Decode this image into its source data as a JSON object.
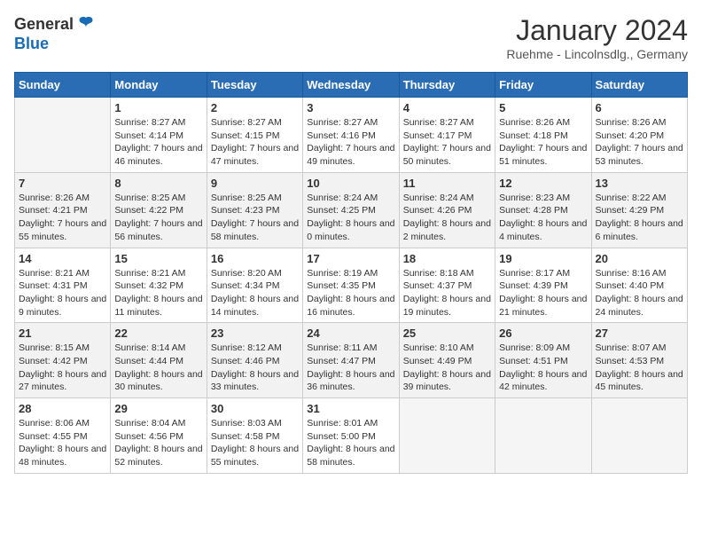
{
  "header": {
    "logo_general": "General",
    "logo_blue": "Blue",
    "month_title": "January 2024",
    "subtitle": "Ruehme - Lincolnsdlg., Germany"
  },
  "weekdays": [
    "Sunday",
    "Monday",
    "Tuesday",
    "Wednesday",
    "Thursday",
    "Friday",
    "Saturday"
  ],
  "weeks": [
    [
      {
        "num": "",
        "sunrise": "",
        "sunset": "",
        "daylight": ""
      },
      {
        "num": "1",
        "sunrise": "Sunrise: 8:27 AM",
        "sunset": "Sunset: 4:14 PM",
        "daylight": "Daylight: 7 hours and 46 minutes."
      },
      {
        "num": "2",
        "sunrise": "Sunrise: 8:27 AM",
        "sunset": "Sunset: 4:15 PM",
        "daylight": "Daylight: 7 hours and 47 minutes."
      },
      {
        "num": "3",
        "sunrise": "Sunrise: 8:27 AM",
        "sunset": "Sunset: 4:16 PM",
        "daylight": "Daylight: 7 hours and 49 minutes."
      },
      {
        "num": "4",
        "sunrise": "Sunrise: 8:27 AM",
        "sunset": "Sunset: 4:17 PM",
        "daylight": "Daylight: 7 hours and 50 minutes."
      },
      {
        "num": "5",
        "sunrise": "Sunrise: 8:26 AM",
        "sunset": "Sunset: 4:18 PM",
        "daylight": "Daylight: 7 hours and 51 minutes."
      },
      {
        "num": "6",
        "sunrise": "Sunrise: 8:26 AM",
        "sunset": "Sunset: 4:20 PM",
        "daylight": "Daylight: 7 hours and 53 minutes."
      }
    ],
    [
      {
        "num": "7",
        "sunrise": "Sunrise: 8:26 AM",
        "sunset": "Sunset: 4:21 PM",
        "daylight": "Daylight: 7 hours and 55 minutes."
      },
      {
        "num": "8",
        "sunrise": "Sunrise: 8:25 AM",
        "sunset": "Sunset: 4:22 PM",
        "daylight": "Daylight: 7 hours and 56 minutes."
      },
      {
        "num": "9",
        "sunrise": "Sunrise: 8:25 AM",
        "sunset": "Sunset: 4:23 PM",
        "daylight": "Daylight: 7 hours and 58 minutes."
      },
      {
        "num": "10",
        "sunrise": "Sunrise: 8:24 AM",
        "sunset": "Sunset: 4:25 PM",
        "daylight": "Daylight: 8 hours and 0 minutes."
      },
      {
        "num": "11",
        "sunrise": "Sunrise: 8:24 AM",
        "sunset": "Sunset: 4:26 PM",
        "daylight": "Daylight: 8 hours and 2 minutes."
      },
      {
        "num": "12",
        "sunrise": "Sunrise: 8:23 AM",
        "sunset": "Sunset: 4:28 PM",
        "daylight": "Daylight: 8 hours and 4 minutes."
      },
      {
        "num": "13",
        "sunrise": "Sunrise: 8:22 AM",
        "sunset": "Sunset: 4:29 PM",
        "daylight": "Daylight: 8 hours and 6 minutes."
      }
    ],
    [
      {
        "num": "14",
        "sunrise": "Sunrise: 8:21 AM",
        "sunset": "Sunset: 4:31 PM",
        "daylight": "Daylight: 8 hours and 9 minutes."
      },
      {
        "num": "15",
        "sunrise": "Sunrise: 8:21 AM",
        "sunset": "Sunset: 4:32 PM",
        "daylight": "Daylight: 8 hours and 11 minutes."
      },
      {
        "num": "16",
        "sunrise": "Sunrise: 8:20 AM",
        "sunset": "Sunset: 4:34 PM",
        "daylight": "Daylight: 8 hours and 14 minutes."
      },
      {
        "num": "17",
        "sunrise": "Sunrise: 8:19 AM",
        "sunset": "Sunset: 4:35 PM",
        "daylight": "Daylight: 8 hours and 16 minutes."
      },
      {
        "num": "18",
        "sunrise": "Sunrise: 8:18 AM",
        "sunset": "Sunset: 4:37 PM",
        "daylight": "Daylight: 8 hours and 19 minutes."
      },
      {
        "num": "19",
        "sunrise": "Sunrise: 8:17 AM",
        "sunset": "Sunset: 4:39 PM",
        "daylight": "Daylight: 8 hours and 21 minutes."
      },
      {
        "num": "20",
        "sunrise": "Sunrise: 8:16 AM",
        "sunset": "Sunset: 4:40 PM",
        "daylight": "Daylight: 8 hours and 24 minutes."
      }
    ],
    [
      {
        "num": "21",
        "sunrise": "Sunrise: 8:15 AM",
        "sunset": "Sunset: 4:42 PM",
        "daylight": "Daylight: 8 hours and 27 minutes."
      },
      {
        "num": "22",
        "sunrise": "Sunrise: 8:14 AM",
        "sunset": "Sunset: 4:44 PM",
        "daylight": "Daylight: 8 hours and 30 minutes."
      },
      {
        "num": "23",
        "sunrise": "Sunrise: 8:12 AM",
        "sunset": "Sunset: 4:46 PM",
        "daylight": "Daylight: 8 hours and 33 minutes."
      },
      {
        "num": "24",
        "sunrise": "Sunrise: 8:11 AM",
        "sunset": "Sunset: 4:47 PM",
        "daylight": "Daylight: 8 hours and 36 minutes."
      },
      {
        "num": "25",
        "sunrise": "Sunrise: 8:10 AM",
        "sunset": "Sunset: 4:49 PM",
        "daylight": "Daylight: 8 hours and 39 minutes."
      },
      {
        "num": "26",
        "sunrise": "Sunrise: 8:09 AM",
        "sunset": "Sunset: 4:51 PM",
        "daylight": "Daylight: 8 hours and 42 minutes."
      },
      {
        "num": "27",
        "sunrise": "Sunrise: 8:07 AM",
        "sunset": "Sunset: 4:53 PM",
        "daylight": "Daylight: 8 hours and 45 minutes."
      }
    ],
    [
      {
        "num": "28",
        "sunrise": "Sunrise: 8:06 AM",
        "sunset": "Sunset: 4:55 PM",
        "daylight": "Daylight: 8 hours and 48 minutes."
      },
      {
        "num": "29",
        "sunrise": "Sunrise: 8:04 AM",
        "sunset": "Sunset: 4:56 PM",
        "daylight": "Daylight: 8 hours and 52 minutes."
      },
      {
        "num": "30",
        "sunrise": "Sunrise: 8:03 AM",
        "sunset": "Sunset: 4:58 PM",
        "daylight": "Daylight: 8 hours and 55 minutes."
      },
      {
        "num": "31",
        "sunrise": "Sunrise: 8:01 AM",
        "sunset": "Sunset: 5:00 PM",
        "daylight": "Daylight: 8 hours and 58 minutes."
      },
      {
        "num": "",
        "sunrise": "",
        "sunset": "",
        "daylight": ""
      },
      {
        "num": "",
        "sunrise": "",
        "sunset": "",
        "daylight": ""
      },
      {
        "num": "",
        "sunrise": "",
        "sunset": "",
        "daylight": ""
      }
    ]
  ]
}
